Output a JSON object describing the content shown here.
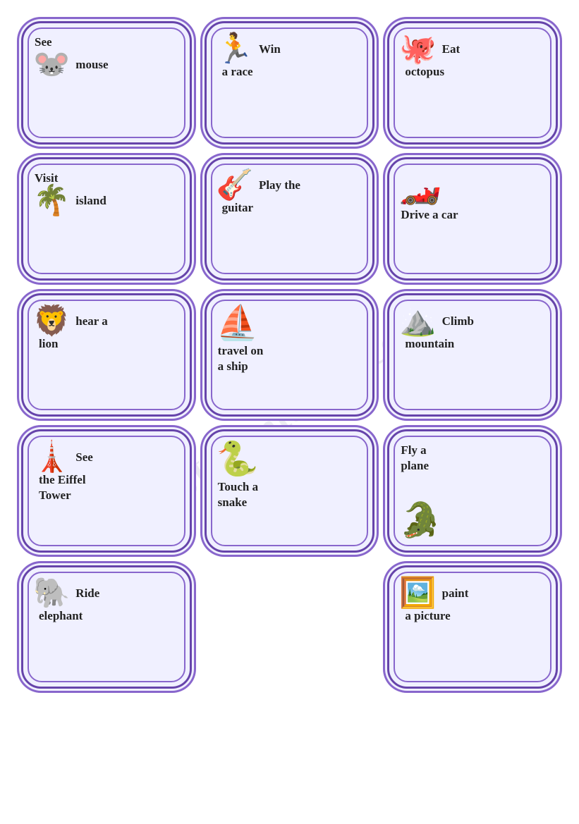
{
  "watermark": "ESLprintables.com",
  "cards": [
    {
      "id": "see-mouse",
      "icon": "🐭",
      "text": "See\nmouse",
      "line1": "See",
      "line2": "mouse"
    },
    {
      "id": "win-race",
      "icon": "🏃",
      "text": "Win\na race",
      "line1": "Win",
      "line2": "a race"
    },
    {
      "id": "eat-octopus",
      "icon": "🐙",
      "text": "Eat\noctopus",
      "line1": "Eat",
      "line2": "octopus"
    },
    {
      "id": "visit-island",
      "icon": "🌴",
      "text": "Visit\nisland",
      "line1": "Visit",
      "line2": "island"
    },
    {
      "id": "play-guitar",
      "icon": "🎸",
      "text": "Play the\nguitar",
      "line1": "Play the",
      "line2": "guitar"
    },
    {
      "id": "drive-car",
      "icon": "🏎️",
      "text": "Drive a car",
      "line1": "Drive a car",
      "line2": ""
    },
    {
      "id": "hear-lion",
      "icon": "🦁",
      "text": "hear a\nlion",
      "line1": "hear a",
      "line2": "lion"
    },
    {
      "id": "travel-ship",
      "icon": "⛵",
      "text": "travel on\na ship",
      "line1": "travel on",
      "line2": "a ship"
    },
    {
      "id": "climb-mountain",
      "icon": "⛰️",
      "text": "Climb\nmountain",
      "line1": "Climb",
      "line2": "mountain"
    },
    {
      "id": "eiffel-tower",
      "icon": "🗼",
      "text": "See\nthe Eiffel\nTower",
      "line1": "See",
      "line2": "the Eiffel",
      "line3": "Tower"
    },
    {
      "id": "touch-snake",
      "icon": "🐍",
      "text": "Touch a\nsnake",
      "line1": "Touch a",
      "line2": "snake"
    },
    {
      "id": "fly-plane",
      "icon": "🐊",
      "text": "Fly a\nplane",
      "line1": "Fly a",
      "line2": "plane",
      "iconBottom": true
    },
    {
      "id": "ride-elephant",
      "icon": "🐘",
      "text": "Ride\nelephant",
      "line1": "Ride",
      "line2": "elephant"
    },
    {
      "id": "empty",
      "icon": "",
      "text": "",
      "line1": "",
      "line2": ""
    },
    {
      "id": "paint-picture",
      "icon": "🖼️",
      "text": "paint\na picture",
      "line1": "paint",
      "line2": "a picture"
    }
  ]
}
